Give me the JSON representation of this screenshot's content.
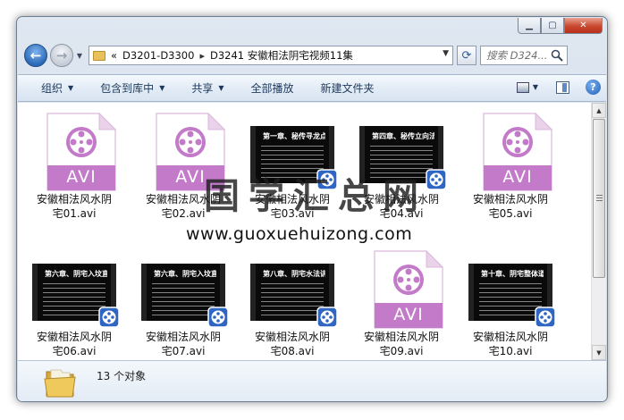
{
  "address": {
    "overflow": "«",
    "crumbs": [
      "D3201-D3300",
      "D3241 安徽相法阴宅视频11集"
    ]
  },
  "search": {
    "placeholder": "搜索 D324..."
  },
  "toolbar": {
    "organize": "组织",
    "include_library": "包含到库中",
    "share": "共享",
    "play_all": "全部播放",
    "new_folder": "新建文件夹"
  },
  "files": [
    {
      "line1": "安徽相法风水阴",
      "line2": "宅01.avi",
      "thumb": "avi",
      "frame_title": ""
    },
    {
      "line1": "安徽相法风水阴",
      "line2": "宅02.avi",
      "thumb": "avi",
      "frame_title": ""
    },
    {
      "line1": "安徽相法风水阴",
      "line2": "宅03.avi",
      "thumb": "video",
      "frame_title": "第一章、秘传寻龙点穴之"
    },
    {
      "line1": "安徽相法风水阴",
      "line2": "宅04.avi",
      "thumb": "video",
      "frame_title": "第四章、秘传立向法诀"
    },
    {
      "line1": "安徽相法风水阴",
      "line2": "宅05.avi",
      "thumb": "avi",
      "frame_title": ""
    },
    {
      "line1": "安徽相法风水阴",
      "line2": "宅06.avi",
      "thumb": "video",
      "frame_title": "第六章、阴宅入坟直断"
    },
    {
      "line1": "安徽相法风水阴",
      "line2": "宅07.avi",
      "thumb": "video",
      "frame_title": "第六章、阴宅入坟直断"
    },
    {
      "line1": "安徽相法风水阴",
      "line2": "宅08.avi",
      "thumb": "video",
      "frame_title": "第八章、阴宅水法讲解"
    },
    {
      "line1": "安徽相法风水阴",
      "line2": "宅09.avi",
      "thumb": "avi",
      "frame_title": ""
    },
    {
      "line1": "安徽相法风水阴",
      "line2": "宅10.avi",
      "thumb": "video",
      "frame_title": "第十章、阴宅整体道理"
    }
  ],
  "avi_label": "AVI",
  "watermark": {
    "text": "国学汇总网",
    "url": "www.guoxuehuizong.com"
  },
  "status": {
    "count": "13 个对象"
  },
  "colors": {
    "avi_purple": "#c27ac9",
    "accent_blue": "#2b69b8"
  }
}
